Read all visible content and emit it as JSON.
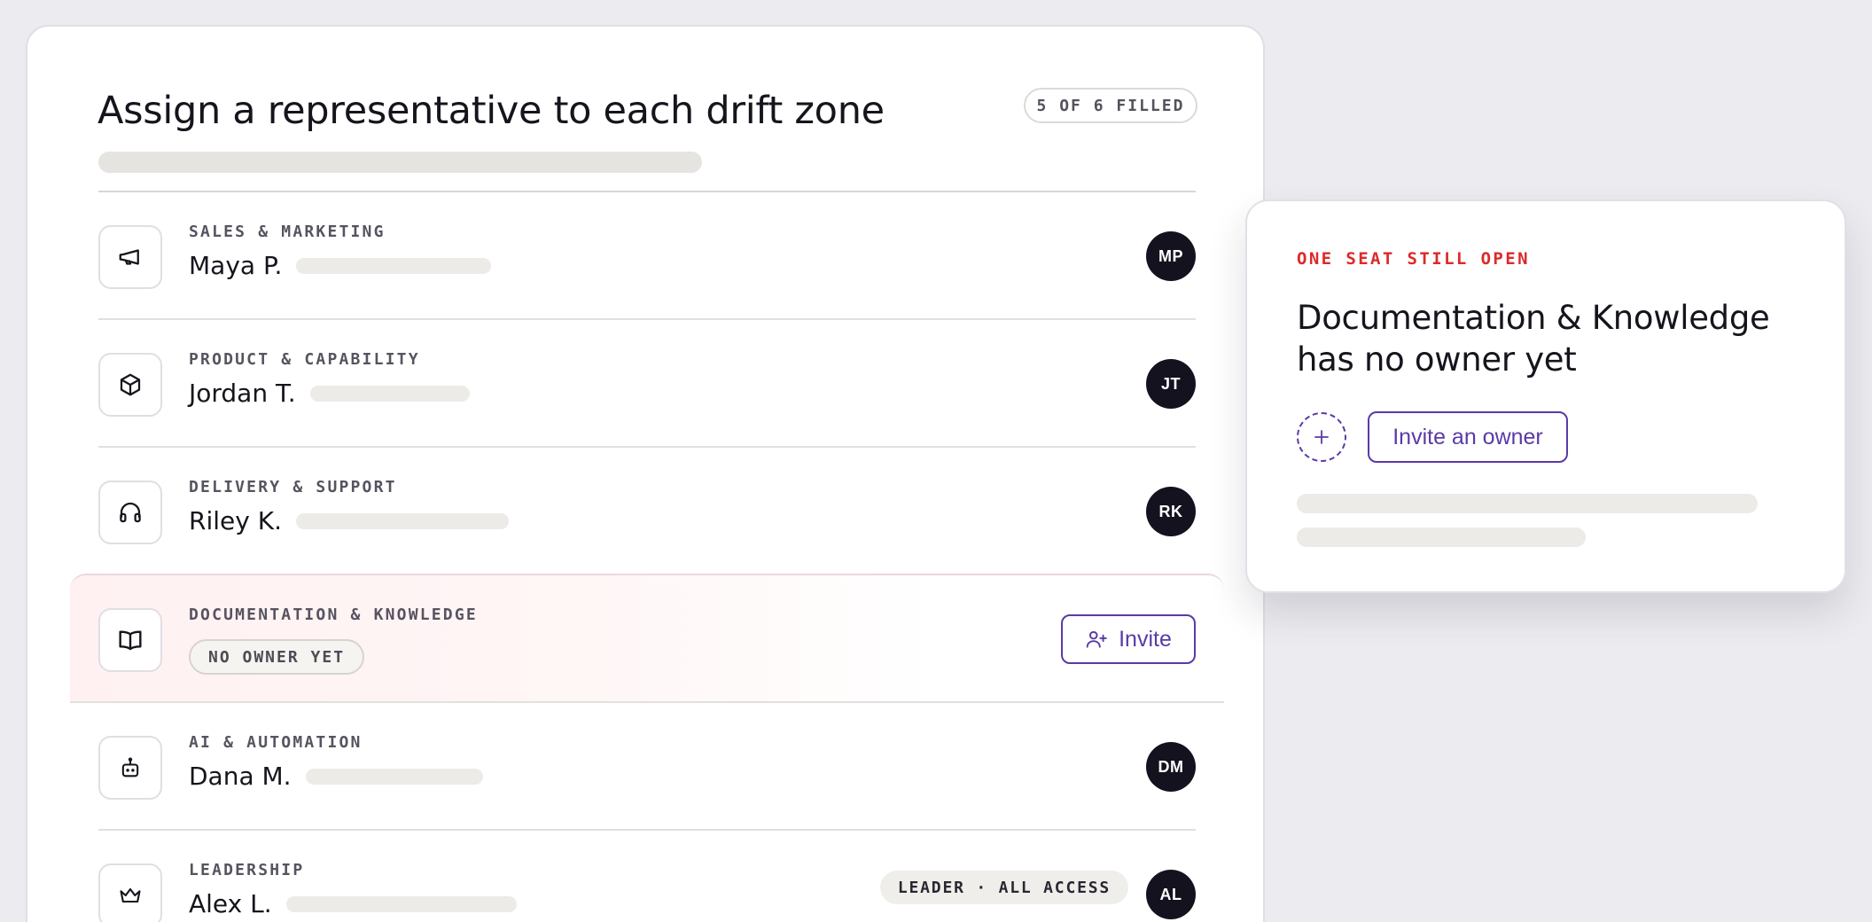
{
  "header": {
    "title": "Assign a representative to each drift zone",
    "filled_status": "5 OF 6 FILLED"
  },
  "rows": [
    {
      "label": "SALES & MARKETING",
      "name": "Maya P.",
      "initials": "MP",
      "icon": "megaphone-icon"
    },
    {
      "label": "PRODUCT & CAPABILITY",
      "name": "Jordan T.",
      "initials": "JT",
      "icon": "cube-icon"
    },
    {
      "label": "DELIVERY & SUPPORT",
      "name": "Riley K.",
      "initials": "RK",
      "icon": "headphones-icon"
    },
    {
      "label": "DOCUMENTATION & KNOWLEDGE",
      "status": "NO OWNER YET",
      "action": "Invite",
      "icon": "book-icon"
    },
    {
      "label": "AI & AUTOMATION",
      "name": "Dana M.",
      "initials": "DM",
      "icon": "robot-icon"
    },
    {
      "label": "LEADERSHIP",
      "name": "Alex L.",
      "initials": "AL",
      "badge": "LEADER · ALL ACCESS",
      "icon": "crown-icon"
    }
  ],
  "side_panel": {
    "kicker": "ONE SEAT STILL OPEN",
    "title": "Documentation & Knowledge has no owner yet",
    "invite_label": "Invite an owner"
  },
  "colors": {
    "accent": "#5b3aa6",
    "alert": "#dc2a2a",
    "avatar_bg": "#15121f"
  }
}
